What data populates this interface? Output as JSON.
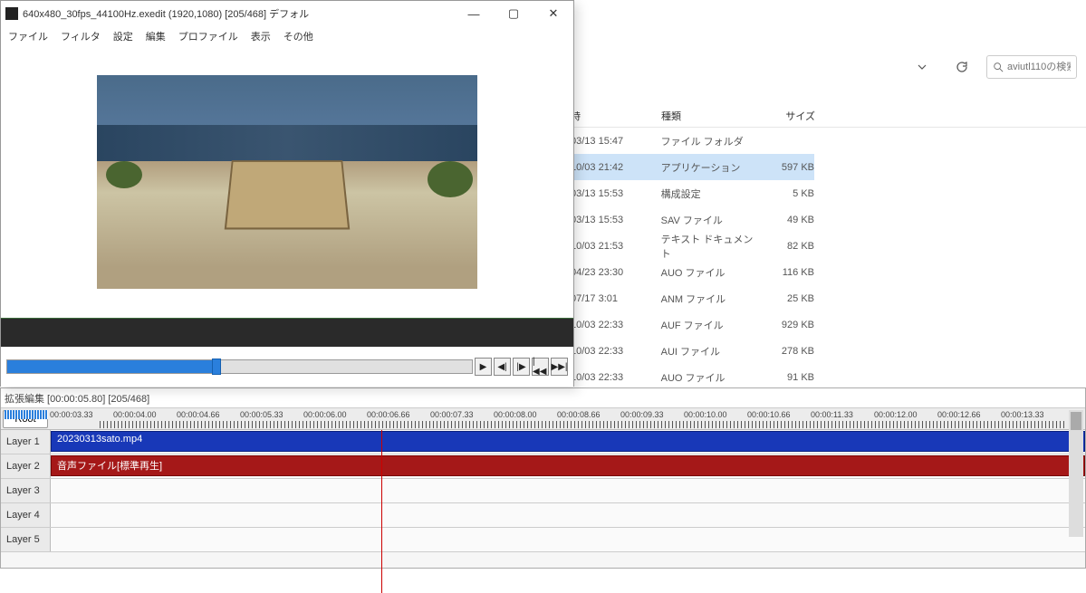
{
  "explorer": {
    "search_placeholder": "aviutl110の検索",
    "columns": {
      "date": "時",
      "type": "種類",
      "size": "サイズ"
    },
    "rows": [
      {
        "date": "03/13 15:47",
        "type": "ファイル フォルダ",
        "size": ""
      },
      {
        "date": "10/03 21:42",
        "type": "アプリケーション",
        "size": "597 KB",
        "selected": true
      },
      {
        "date": "03/13 15:53",
        "type": "構成設定",
        "size": "5 KB"
      },
      {
        "date": "03/13 15:53",
        "type": "SAV ファイル",
        "size": "49 KB"
      },
      {
        "date": "10/03 21:53",
        "type": "テキスト ドキュメント",
        "size": "82 KB"
      },
      {
        "date": "04/23 23:30",
        "type": "AUO ファイル",
        "size": "116 KB"
      },
      {
        "date": "07/17 3:01",
        "type": "ANM ファイル",
        "size": "25 KB"
      },
      {
        "date": "10/03 22:33",
        "type": "AUF ファイル",
        "size": "929 KB"
      },
      {
        "date": "10/03 22:33",
        "type": "AUI ファイル",
        "size": "278 KB"
      },
      {
        "date": "10/03 22:33",
        "type": "AUO ファイル",
        "size": "91 KB"
      }
    ]
  },
  "preview": {
    "title": "640x480_30fps_44100Hz.exedit (1920,1080)  [205/468]  デフォル",
    "menu": [
      "ファイル",
      "フィルタ",
      "設定",
      "編集",
      "プロファイル",
      "表示",
      "その他"
    ],
    "transport": {
      "play": "▶",
      "step_back": "◀|",
      "step_fwd": "|▶",
      "start": "|◀◀",
      "end": "▶▶|"
    }
  },
  "timeline": {
    "title": "拡張編集 [00:00:05.80] [205/468]",
    "root": "Root",
    "marks": [
      "00:00:03.33",
      "00:00:04.00",
      "00:00:04.66",
      "00:00:05.33",
      "00:00:06.00",
      "00:00:06.66",
      "00:00:07.33",
      "00:00:08.00",
      "00:00:08.66",
      "00:00:09.33",
      "00:00:10.00",
      "00:00:10.66",
      "00:00:11.33",
      "00:00:12.00",
      "00:00:12.66",
      "00:00:13.33"
    ],
    "layers": [
      {
        "label": "Layer 1",
        "clip": {
          "text": "20230313sato.mp4",
          "color": "blue"
        }
      },
      {
        "label": "Layer 2",
        "clip": {
          "text": "音声ファイル[標準再生]",
          "color": "red"
        }
      },
      {
        "label": "Layer 3"
      },
      {
        "label": "Layer 4"
      },
      {
        "label": "Layer 5"
      }
    ]
  }
}
